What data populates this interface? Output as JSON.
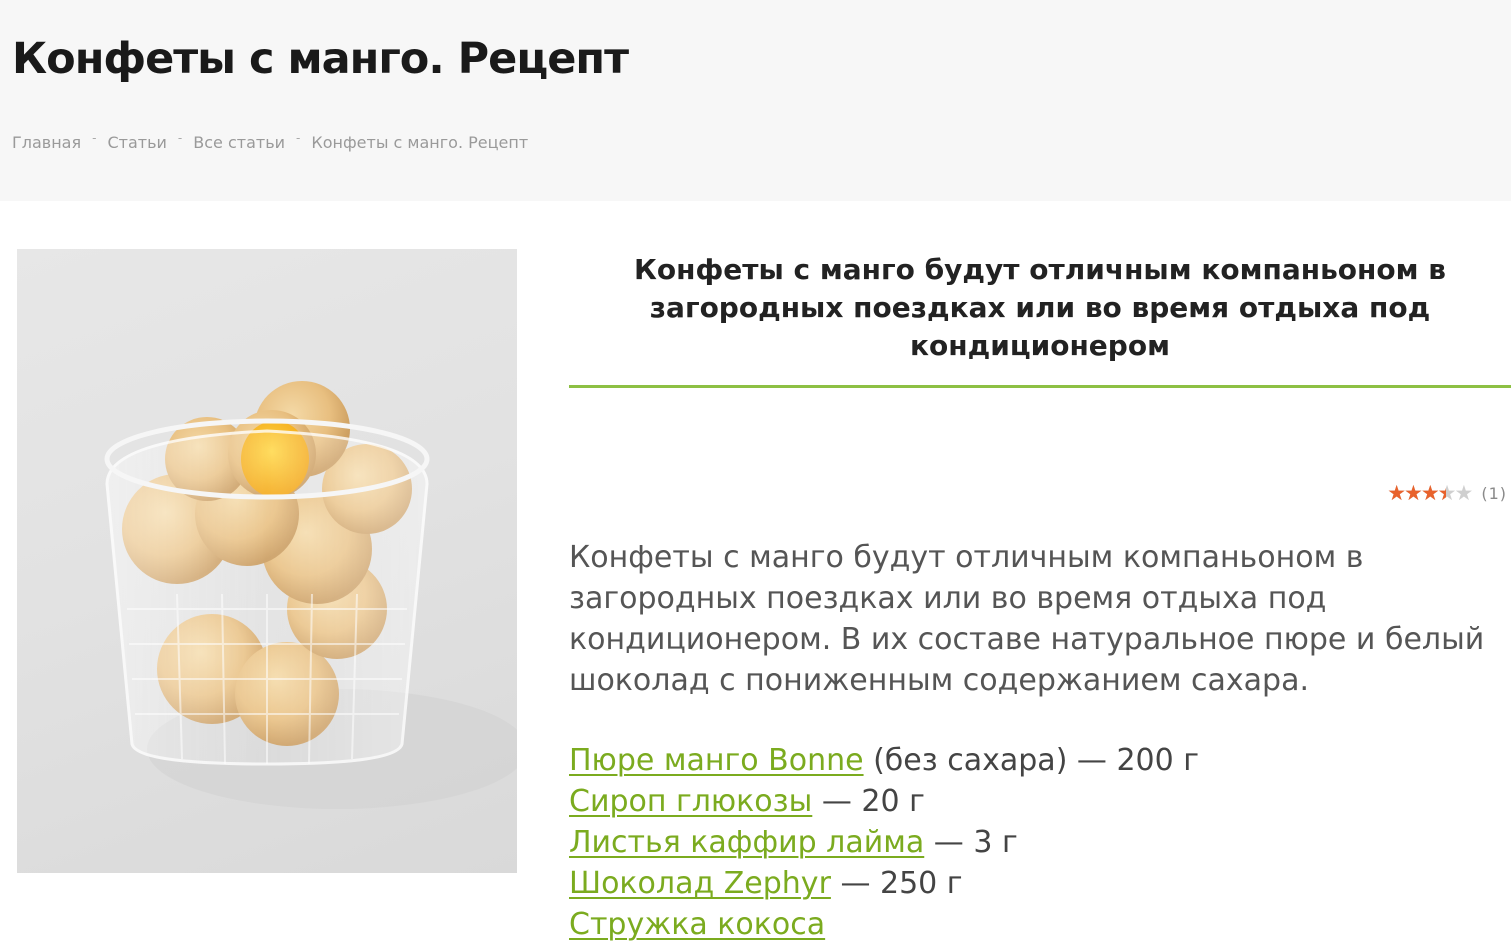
{
  "page": {
    "title": "Конфеты с манго. Рецепт"
  },
  "breadcrumb": {
    "items": [
      "Главная",
      "Статьи",
      "Все статьи",
      "Конфеты с манго. Рецепт"
    ],
    "separator": "-"
  },
  "article": {
    "lead_title": "Конфеты с манго будут отличным компаньоном в загородных поездках или во время отдыха под кондиционером",
    "rating": {
      "value": 3.5,
      "max": 5,
      "stars_glyph": "★★★★★",
      "count_label": "(1)",
      "fill_color": "#e8622c"
    },
    "intro": "Конфеты с манго будут отличным компаньоном в загородных поездках или во время отдыха под кондиционером. В их составе натуральное пюре и белый шоколад с пониженным содержанием сахара.",
    "ingredients": [
      {
        "name": "Пюре манго Bonne",
        "note": " (без сахара) — 200 г"
      },
      {
        "name": "Сироп глюкозы",
        "note": " — 20 г"
      },
      {
        "name": "Листья каффир лайма",
        "note": " — 3 г"
      },
      {
        "name": "Шоколад Zephyr",
        "note": " — 250 г"
      },
      {
        "name": "Стружка кокоса",
        "note": ""
      }
    ]
  },
  "colors": {
    "accent": "#8dc044",
    "link": "#7bab1f",
    "header_bg": "#f7f7f7"
  }
}
